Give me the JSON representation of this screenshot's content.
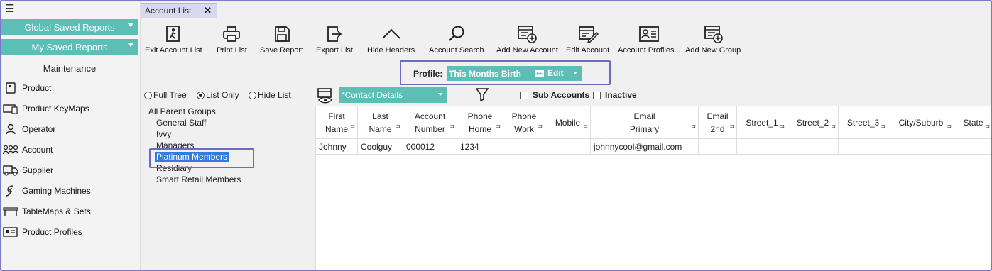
{
  "sidebar": {
    "global_saved_reports": "Global Saved Reports",
    "my_saved_reports": "My Saved Reports",
    "section_title": "Maintenance",
    "items": [
      {
        "label": "Product",
        "icon": "product-icon"
      },
      {
        "label": "Product KeyMaps",
        "icon": "keymap-icon"
      },
      {
        "label": "Operator",
        "icon": "operator-icon"
      },
      {
        "label": "Account",
        "icon": "account-icon"
      },
      {
        "label": "Supplier",
        "icon": "supplier-icon"
      },
      {
        "label": "Gaming Machines",
        "icon": "gaming-icon"
      },
      {
        "label": "TableMaps & Sets",
        "icon": "table-icon"
      },
      {
        "label": "Product Profiles",
        "icon": "profile-icon"
      }
    ]
  },
  "tab": {
    "label": "Account List",
    "close": "✕"
  },
  "toolbar": {
    "items": [
      {
        "label": "Exit Account List",
        "icon": "exit-icon"
      },
      {
        "label": "Print List",
        "icon": "print-icon"
      },
      {
        "label": "Save Report",
        "icon": "save-icon"
      },
      {
        "label": "Export List",
        "icon": "export-icon"
      },
      {
        "label": "Hide Headers",
        "icon": "chevron-up-icon"
      },
      {
        "label": "Account Search",
        "icon": "search-icon"
      },
      {
        "label": "Add New Account",
        "icon": "add-account-icon"
      },
      {
        "label": "Edit Account",
        "icon": "edit-account-icon"
      },
      {
        "label": "Account Profiles...",
        "icon": "account-profiles-icon"
      },
      {
        "label": "Add New Group",
        "icon": "add-group-icon"
      }
    ]
  },
  "profile": {
    "label": "Profile:",
    "value": "This Months Birth",
    "edit": "Edit"
  },
  "tree_options": {
    "full_tree": "Full Tree",
    "list_only": "List Only",
    "hide_list": "Hide List",
    "selected": "List Only"
  },
  "tree": {
    "root": "All Parent Groups",
    "items": [
      "General Staff",
      "Ivvy",
      "Managers",
      "Platinum Members",
      "Residiary",
      "Smart Retail Members"
    ],
    "selected": "Platinum Members"
  },
  "filters": {
    "contact_details": "*Contact Details",
    "sub_accounts": "Sub Accounts",
    "inactive": "Inactive"
  },
  "grid": {
    "columns": [
      "First\nName",
      "Last\nName",
      "Account\nNumber",
      "Phone\nHome",
      "Phone\nWork",
      "Mobile",
      "Email\nPrimary",
      "Email\n2nd",
      "Street_1",
      "Street_2",
      "Street_3",
      "City/Suburb",
      "State"
    ],
    "rows": [
      [
        "Johnny",
        "Coolguy",
        "000012",
        "1234",
        "",
        "",
        "johnnycool@gmail.com",
        "",
        "",
        "",
        "",
        "",
        ""
      ]
    ]
  }
}
